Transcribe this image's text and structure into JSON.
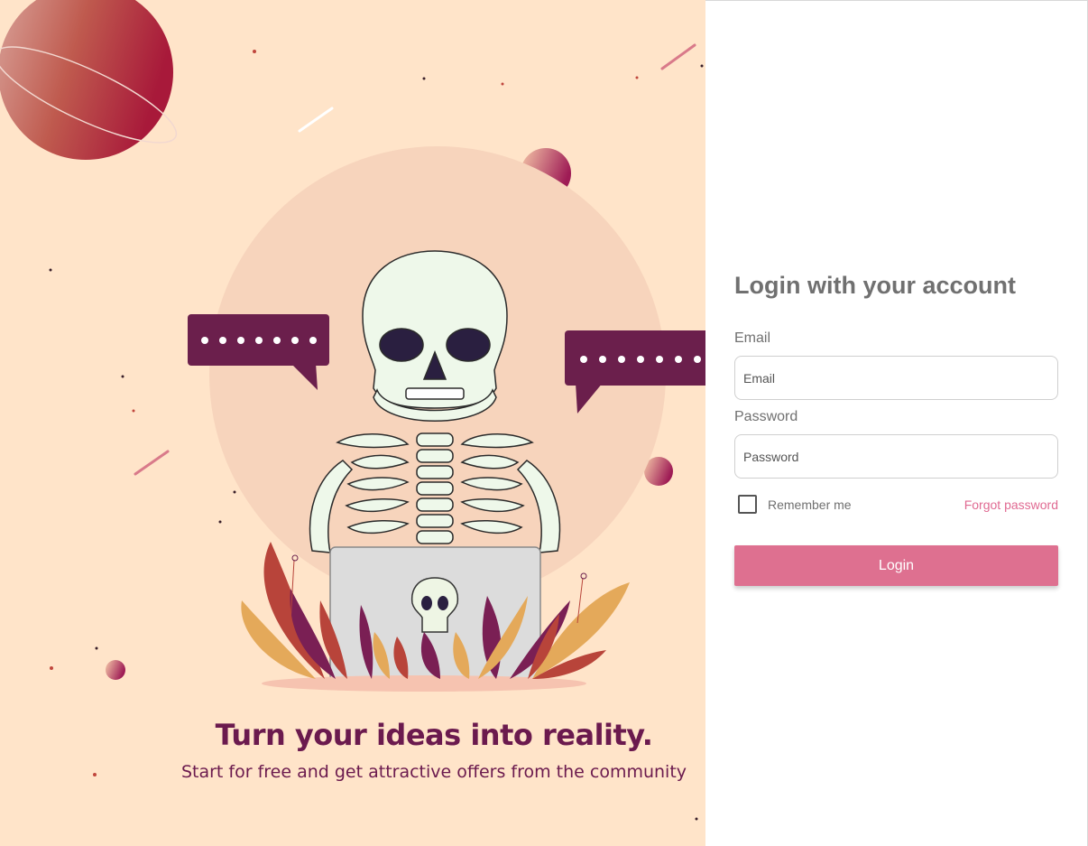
{
  "hero": {
    "title": "Turn your ideas into reality.",
    "subtitle": "Start for free and get attractive offers from the community"
  },
  "login": {
    "heading": "Login with your account",
    "email_label": "Email",
    "email_placeholder": "Email",
    "password_label": "Password",
    "password_placeholder": "Password",
    "remember_label": "Remember me",
    "remember_checked": false,
    "forgot_label": "Forgot password",
    "submit_label": "Login"
  },
  "colors": {
    "art_background": "#ffe4c9",
    "brand_dark": "#6b1a4e",
    "accent": "#de7090",
    "link": "#e06a92",
    "text_gray": "#707070"
  },
  "illustration": {
    "icons": [
      "planet-icon",
      "skeleton-icon",
      "laptop-icon",
      "speech-bubble-icon",
      "leaves-icon"
    ]
  }
}
